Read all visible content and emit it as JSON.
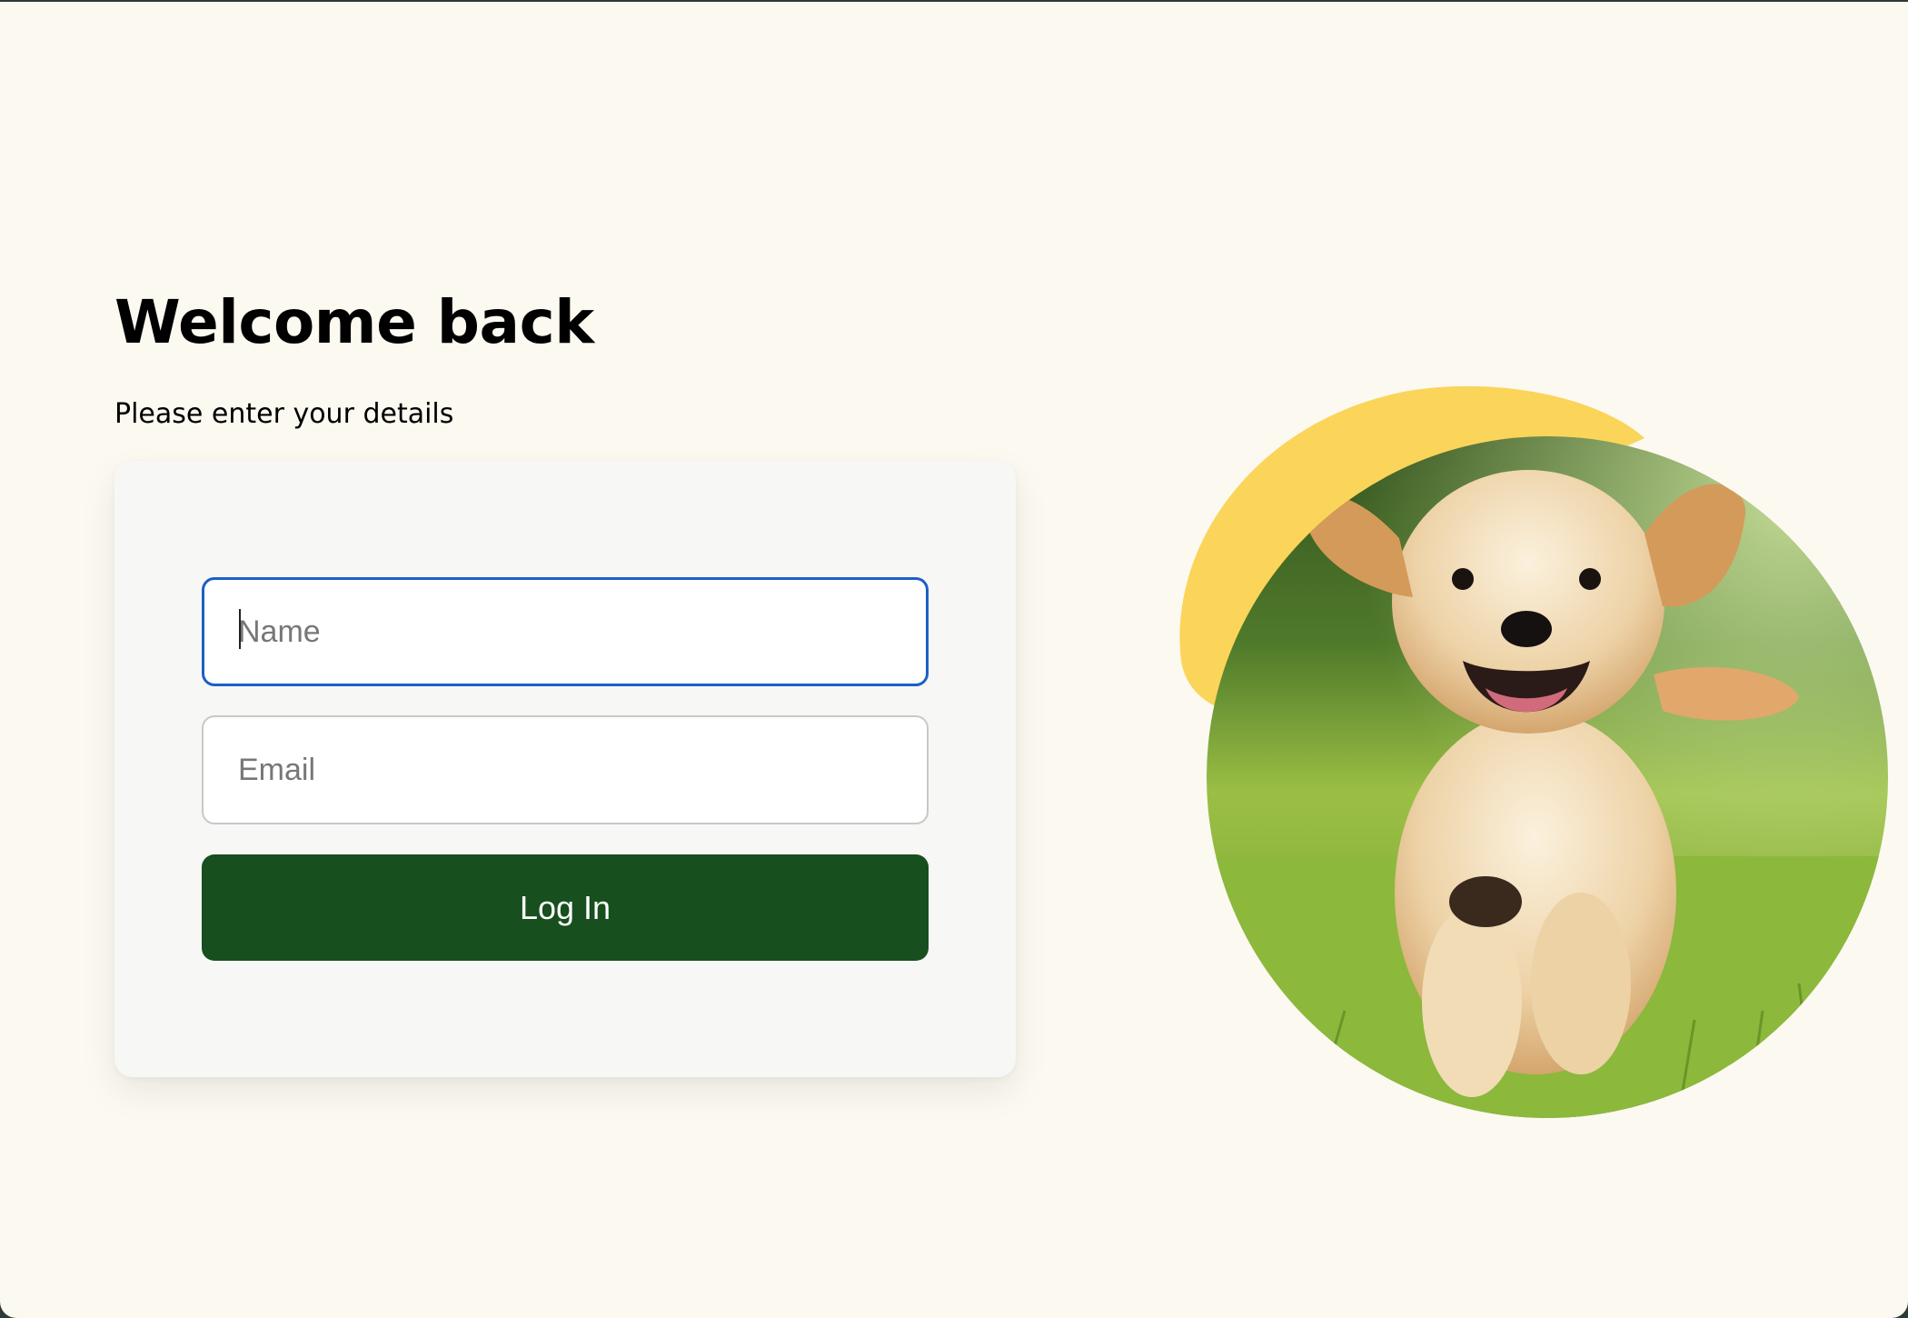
{
  "login": {
    "title": "Welcome back",
    "subtitle": "Please enter your details",
    "name_placeholder": "Name",
    "name_value": "",
    "email_placeholder": "Email",
    "email_value": "",
    "submit_label": "Log In"
  },
  "hero": {
    "image_subject": "golden retriever puppy running in grass",
    "blob_color": "#fbd45a"
  },
  "colors": {
    "page_background": "#fcf9f1",
    "card_background": "#f7f7f6",
    "button_background": "#174f1e",
    "focus_border": "#1c5fc7"
  }
}
